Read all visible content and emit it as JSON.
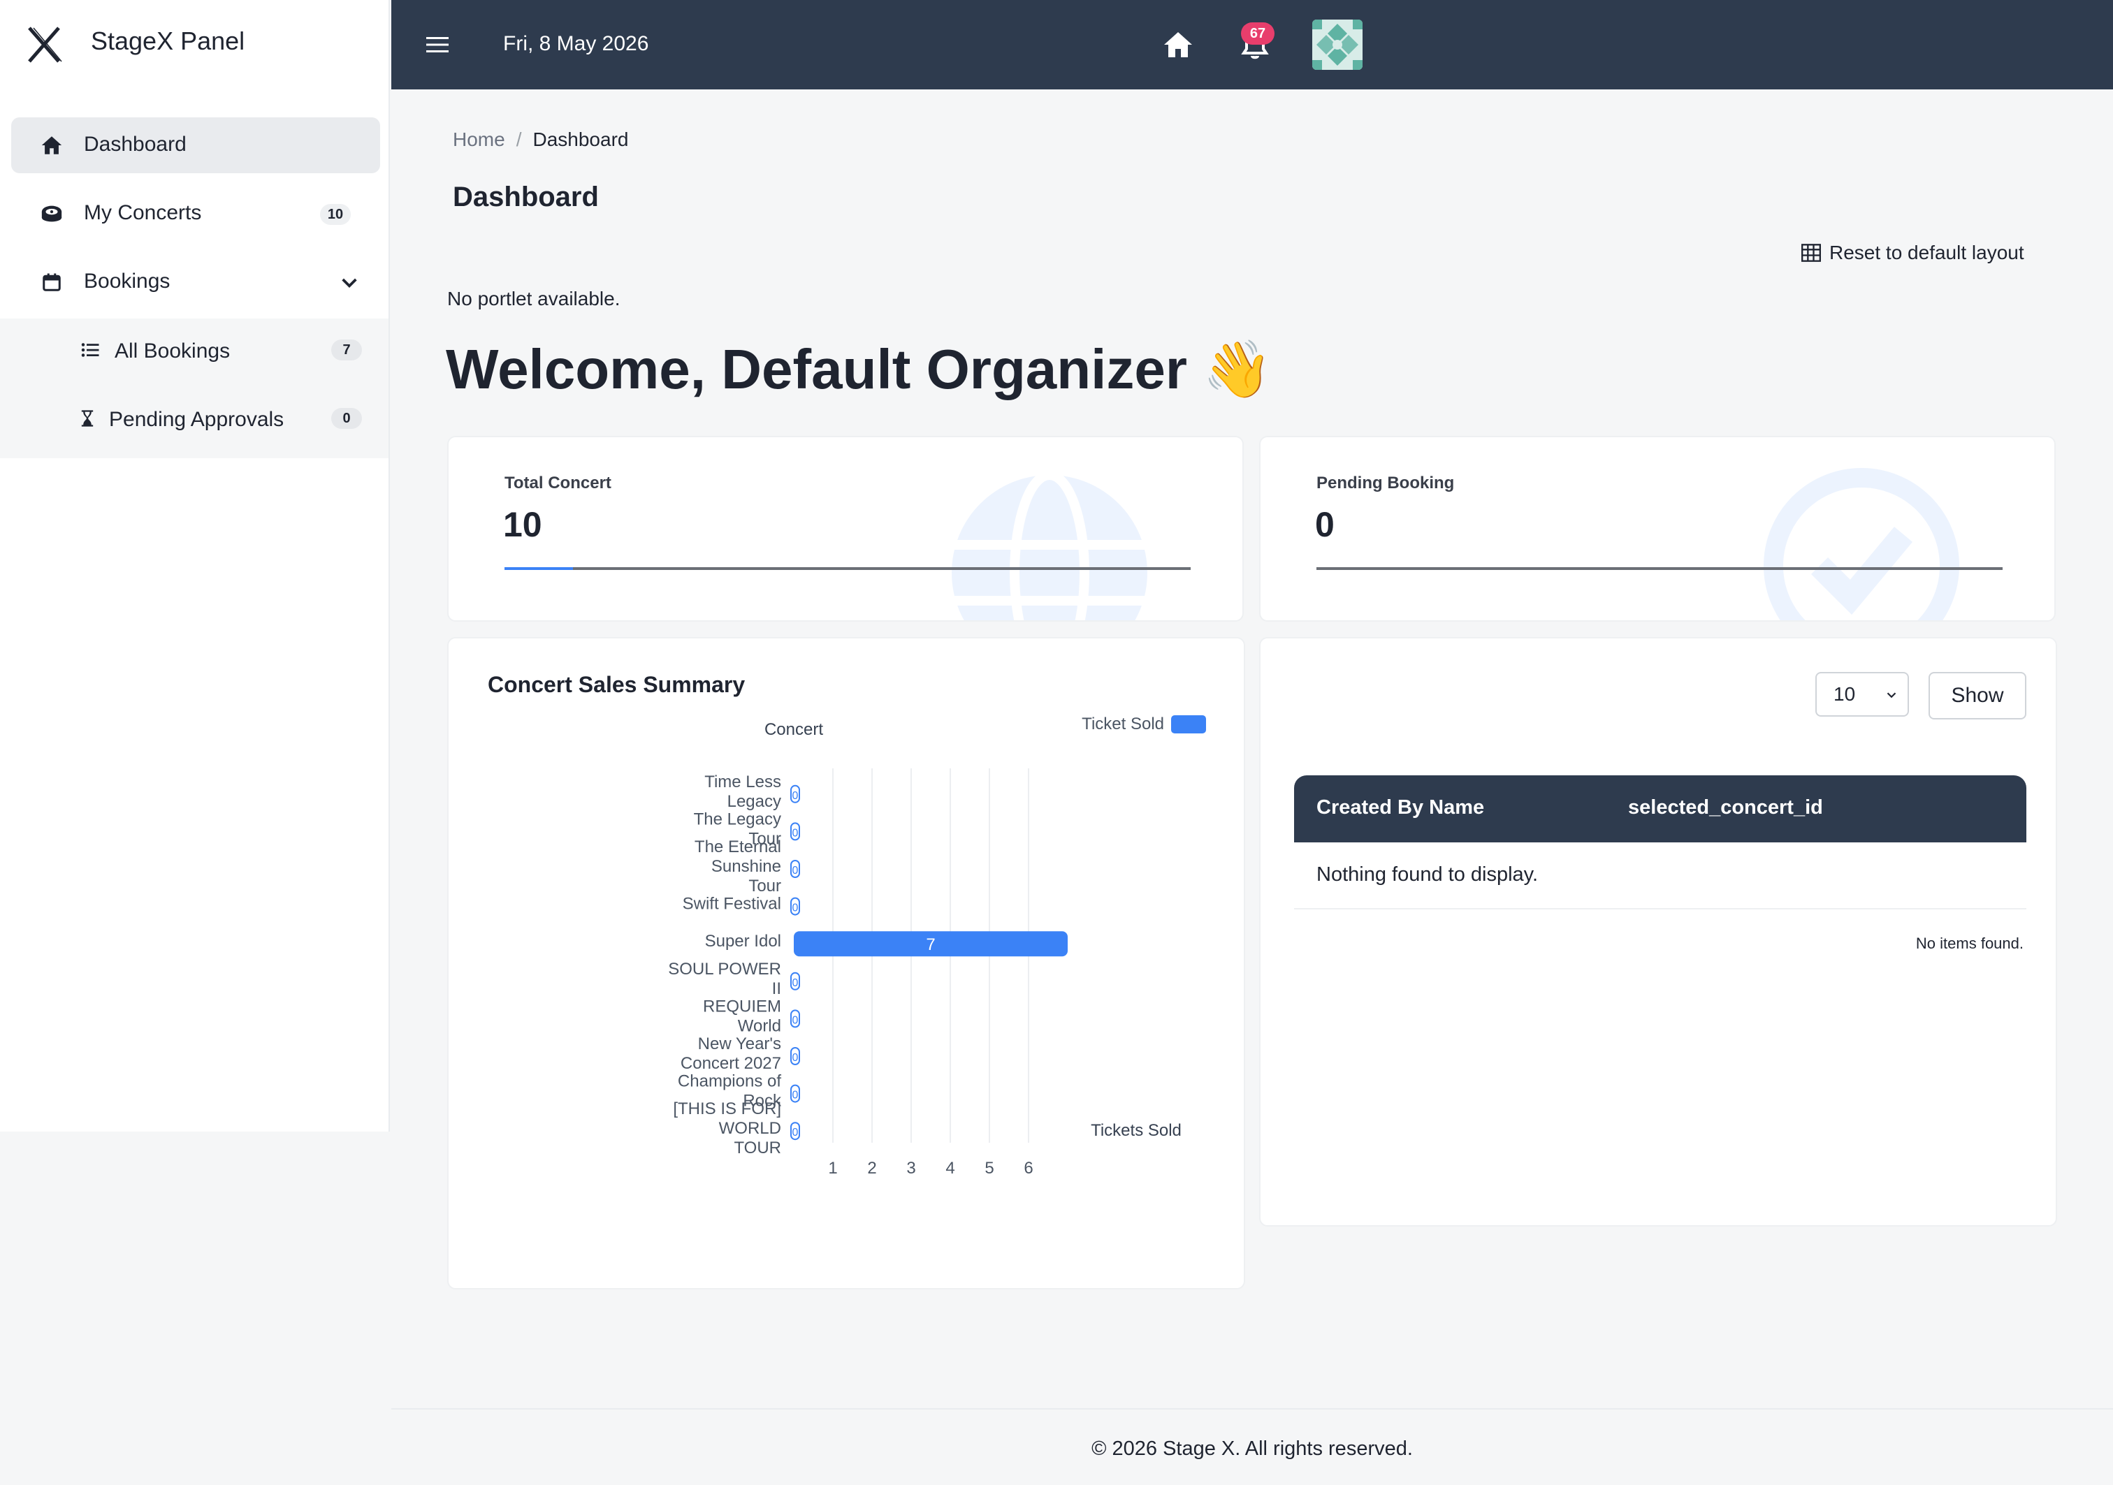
{
  "brand": {
    "name": "StageX Panel",
    "logo_icon": "x-logo-icon"
  },
  "sidebar": {
    "items": [
      {
        "label": "Dashboard",
        "icon": "home-icon",
        "active": true
      },
      {
        "label": "My Concerts",
        "icon": "album-icon",
        "badge": "10"
      },
      {
        "label": "Bookings",
        "icon": "calendar-icon",
        "expanded": true
      }
    ],
    "sub_items": [
      {
        "label": "All Bookings",
        "icon": "list-icon",
        "badge": "7"
      },
      {
        "label": "Pending Approvals",
        "icon": "hourglass-icon",
        "badge": "0"
      }
    ]
  },
  "topbar": {
    "date": "Fri, 8 May 2026",
    "notification_count": "67",
    "color": "#2e3b4e"
  },
  "breadcrumb": {
    "home": "Home",
    "separator": "/",
    "current": "Dashboard"
  },
  "page": {
    "title": "Dashboard",
    "reset_label": "Reset to default layout",
    "no_portlet": "No portlet available.",
    "welcome": "Welcome, Default Organizer 👋"
  },
  "stats": [
    {
      "label": "Total Concert",
      "value": "10",
      "progress": 0.1,
      "icon": "globe-icon"
    },
    {
      "label": "Pending Booking",
      "value": "0",
      "progress": 0,
      "icon": "check-circle-icon"
    }
  ],
  "chart": {
    "title": "Concert Sales Summary"
  },
  "chart_data": {
    "type": "bar",
    "orientation": "horizontal",
    "ylabel": "Concert",
    "xlabel": "Tickets Sold",
    "legend": {
      "label": "Ticket Sold",
      "position": "top-right"
    },
    "categories": [
      [
        "Time Less",
        "Legacy"
      ],
      [
        "The Legacy",
        "Tour"
      ],
      [
        "The Eternal",
        "Sunshine",
        "Tour"
      ],
      [
        "Swift Festival"
      ],
      [
        "Super Idol"
      ],
      [
        "SOUL POWER",
        "II"
      ],
      [
        "REQUIEM",
        "World"
      ],
      [
        "New Year's",
        "Concert 2027"
      ],
      [
        "Champions of",
        "Rock"
      ],
      [
        "[THIS IS FOR]",
        "WORLD",
        "TOUR"
      ]
    ],
    "series": [
      {
        "values": [
          0,
          0,
          0,
          0,
          7,
          0,
          0,
          0,
          0,
          0
        ]
      }
    ],
    "xticks": [
      "1",
      "2",
      "3",
      "4",
      "5",
      "6"
    ],
    "xlim": [
      0,
      7
    ],
    "grid": true,
    "color": "#3b82f6"
  },
  "table": {
    "page_size": "10",
    "show_label": "Show",
    "columns": [
      "Created By Name",
      "selected_concert_id"
    ],
    "empty_text": "Nothing found to display.",
    "footer_text": "No items found."
  },
  "footer": {
    "text": "© 2026 Stage X. All rights reserved."
  }
}
